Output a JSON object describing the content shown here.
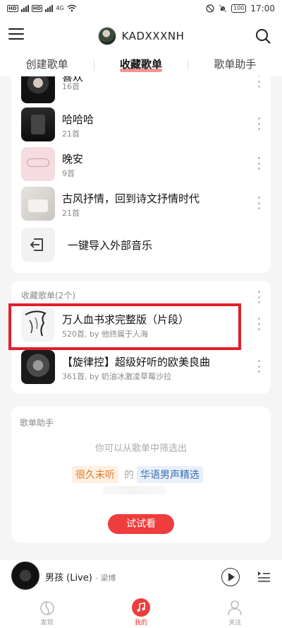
{
  "status": {
    "left_badges": [
      "HD",
      "HD"
    ],
    "network": "4G",
    "battery": "100",
    "time": "17:00"
  },
  "header": {
    "username": "KADXXXNH"
  },
  "tabs": [
    {
      "label": "创建歌单",
      "active": false
    },
    {
      "label": "收藏歌单",
      "active": true
    },
    {
      "label": "歌单助手",
      "active": false
    }
  ],
  "created_playlists": [
    {
      "title": "喜欢",
      "count": "16首"
    },
    {
      "title": "哈哈哈",
      "count": "21首"
    },
    {
      "title": "晚安",
      "count": "9首"
    },
    {
      "title": "古风抒情，回到诗文抒情时代",
      "count": "21首"
    }
  ],
  "import_label": "一键导入外部音乐",
  "collected": {
    "section_title": "收藏歌单(2个)",
    "items": [
      {
        "title": "万人血书求完整版（片段）",
        "meta": "520首, by 他终属于人海"
      },
      {
        "title": "【旋律控】超级好听的欧美良曲",
        "meta": "361首, by 奶油冰激凌草莓沙拉"
      }
    ]
  },
  "helper": {
    "section_title": "歌单助手",
    "hint": "你可以从歌单中筛选出",
    "chip_left": "很久未听",
    "connector": "的",
    "chip_right": "华语男声精选",
    "button": "试试看"
  },
  "player": {
    "title": "男孩 (Live)",
    "artist": "梁博"
  },
  "bottom_nav": [
    {
      "label": "发现",
      "active": false
    },
    {
      "label": "我的",
      "active": true
    },
    {
      "label": "关注",
      "active": false
    }
  ],
  "colors": {
    "accent": "#ef3c3c",
    "highlight_border": "#e0202a",
    "chip_orange_bg": "#fff0e2",
    "chip_orange_text": "#e07b28",
    "chip_blue_bg": "#e8f0fa",
    "chip_blue_text": "#3a6fb0"
  }
}
